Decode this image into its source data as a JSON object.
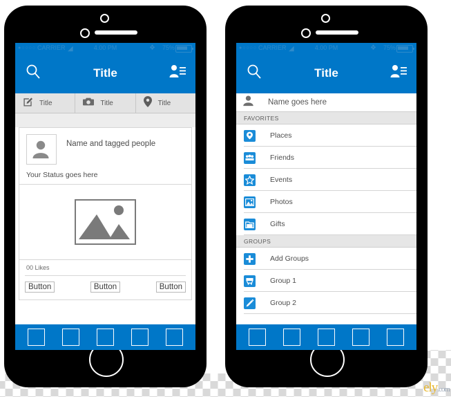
{
  "status_bar": {
    "signal_dots": "●○○○○",
    "carrier": "CARRIER",
    "wifi_icon": "wifi-icon",
    "time": "4.00 PM",
    "bluetooth_icon": "bluetooth-icon",
    "battery_percent": "75%",
    "battery_icon": "battery-icon"
  },
  "theme": {
    "accent_blue": "#0077c8",
    "icon_blue": "#1a8cd8",
    "frame_black": "#000000",
    "text_gray": "#4d4d4d"
  },
  "phone_left": {
    "navbar": {
      "search_icon": "search-icon",
      "title": "Title",
      "contacts_icon": "contacts-icon"
    },
    "tabs": [
      {
        "icon": "compose-icon",
        "label": "Title"
      },
      {
        "icon": "camera-icon",
        "label": "Title"
      },
      {
        "icon": "location-pin-icon",
        "label": "Title"
      }
    ],
    "post": {
      "avatar_icon": "person-avatar-icon",
      "name": "Name and tagged people",
      "status": "Your Status goes here",
      "photo_icon": "image-placeholder-icon",
      "likes": "00 Likes",
      "buttons": [
        "Button",
        "Button",
        "Button"
      ]
    },
    "tabbar_items": [
      "tab-1",
      "tab-2",
      "tab-3",
      "tab-4",
      "tab-5"
    ]
  },
  "phone_right": {
    "navbar": {
      "search_icon": "search-icon",
      "title": "Title",
      "contacts_icon": "contacts-icon"
    },
    "profile": {
      "avatar_icon": "person-avatar-icon",
      "name": "Name goes here"
    },
    "sections": [
      {
        "header": "FAVORITES",
        "items": [
          {
            "icon": "location-pin-icon",
            "label": "Places"
          },
          {
            "icon": "friends-icon",
            "label": "Friends"
          },
          {
            "icon": "star-icon",
            "label": "Events"
          },
          {
            "icon": "photo-icon",
            "label": "Photos"
          },
          {
            "icon": "folder-icon",
            "label": "Gifts"
          }
        ]
      },
      {
        "header": "GROUPS",
        "items": [
          {
            "icon": "plus-icon",
            "label": "Add Groups"
          },
          {
            "icon": "cart-icon",
            "label": "Group 1"
          },
          {
            "icon": "pencil-icon",
            "label": "Group 2"
          }
        ]
      }
    ],
    "tabbar_items": [
      "tab-1",
      "tab-2",
      "tab-3",
      "tab-4",
      "tab-5"
    ]
  },
  "watermark": {
    "text": "ely",
    "suffix": ".com"
  }
}
